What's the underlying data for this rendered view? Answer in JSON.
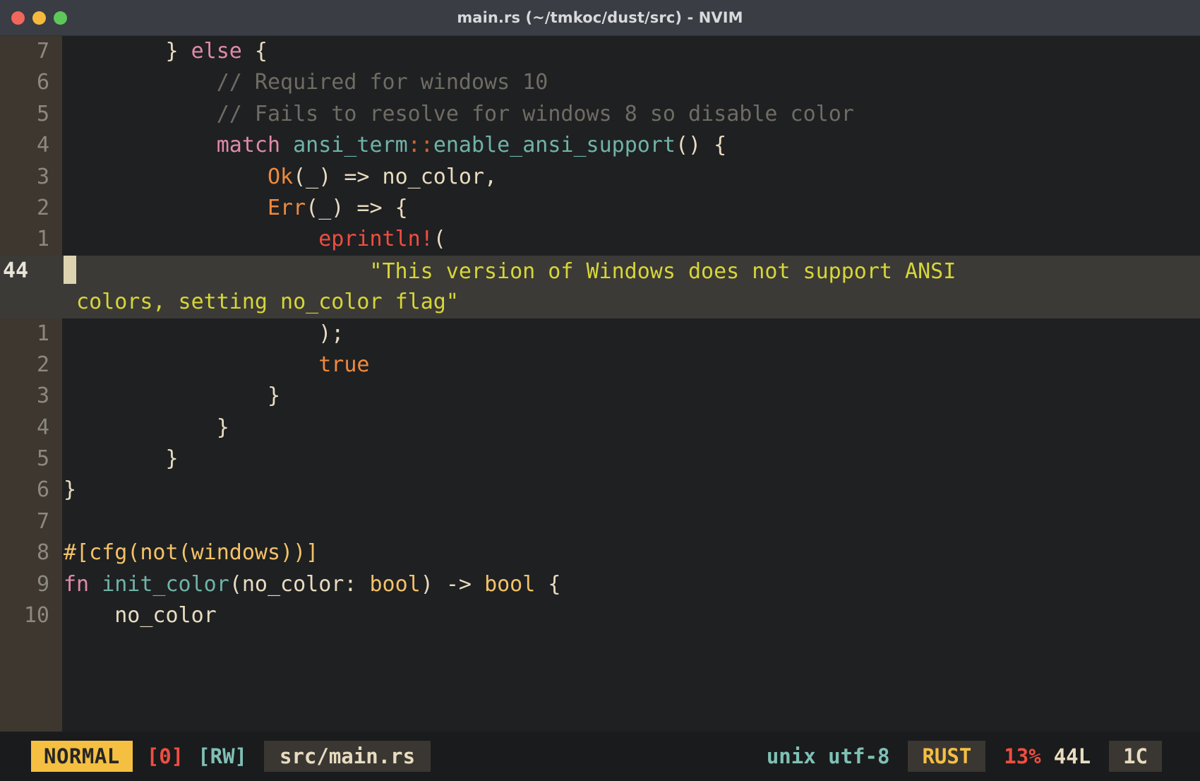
{
  "window": {
    "title": "main.rs (~/tmkoc/dust/src) - NVIM",
    "traffic_lights": {
      "close": "close-button",
      "minimize": "minimize-button",
      "maximize": "maximize-button"
    }
  },
  "editor": {
    "current_line_number": "44",
    "cursor_column": 1,
    "lines": [
      {
        "num": "7",
        "current": false,
        "segments": [
          {
            "t": "        ",
            "c": "plain"
          },
          {
            "t": "}",
            "c": "punct"
          },
          {
            "t": " ",
            "c": "plain"
          },
          {
            "t": "else",
            "c": "keyword"
          },
          {
            "t": " {",
            "c": "punct"
          }
        ]
      },
      {
        "num": "6",
        "current": false,
        "segments": [
          {
            "t": "            // Required for windows 10",
            "c": "comment"
          }
        ]
      },
      {
        "num": "5",
        "current": false,
        "segments": [
          {
            "t": "            // Fails to resolve for windows 8 so disable color",
            "c": "comment"
          }
        ]
      },
      {
        "num": "4",
        "current": false,
        "segments": [
          {
            "t": "            ",
            "c": "plain"
          },
          {
            "t": "match",
            "c": "keyword"
          },
          {
            "t": " ",
            "c": "plain"
          },
          {
            "t": "ansi_term",
            "c": "fn"
          },
          {
            "t": "::",
            "c": "sep"
          },
          {
            "t": "enable_ansi_support",
            "c": "fn"
          },
          {
            "t": "() {",
            "c": "punct"
          }
        ]
      },
      {
        "num": "3",
        "current": false,
        "segments": [
          {
            "t": "                ",
            "c": "plain"
          },
          {
            "t": "Ok",
            "c": "const"
          },
          {
            "t": "(_) ",
            "c": "punct"
          },
          {
            "t": "=>",
            "c": "op"
          },
          {
            "t": " no_color,",
            "c": "ident"
          }
        ]
      },
      {
        "num": "2",
        "current": false,
        "segments": [
          {
            "t": "                ",
            "c": "plain"
          },
          {
            "t": "Err",
            "c": "const"
          },
          {
            "t": "(_) ",
            "c": "punct"
          },
          {
            "t": "=>",
            "c": "op"
          },
          {
            "t": " {",
            "c": "punct"
          }
        ]
      },
      {
        "num": "1",
        "current": false,
        "segments": [
          {
            "t": "                    ",
            "c": "plain"
          },
          {
            "t": "eprintln!",
            "c": "macro"
          },
          {
            "t": "(",
            "c": "punct"
          }
        ]
      },
      {
        "num": "44",
        "current": true,
        "cursor": true,
        "segments": [
          {
            "t": "                       ",
            "c": "plain"
          },
          {
            "t": "\"This version of Windows does not support ANSI",
            "c": "string"
          }
        ]
      },
      {
        "num": "",
        "current": false,
        "wrapped": true,
        "segments": [
          {
            "t": " colors, setting no_color flag\"",
            "c": "string"
          }
        ]
      },
      {
        "num": "1",
        "current": false,
        "segments": [
          {
            "t": "                    );",
            "c": "punct"
          }
        ]
      },
      {
        "num": "2",
        "current": false,
        "segments": [
          {
            "t": "                    ",
            "c": "plain"
          },
          {
            "t": "true",
            "c": "const"
          }
        ]
      },
      {
        "num": "3",
        "current": false,
        "segments": [
          {
            "t": "                }",
            "c": "punct"
          }
        ]
      },
      {
        "num": "4",
        "current": false,
        "segments": [
          {
            "t": "            }",
            "c": "punct"
          }
        ]
      },
      {
        "num": "5",
        "current": false,
        "segments": [
          {
            "t": "        }",
            "c": "punct"
          }
        ]
      },
      {
        "num": "6",
        "current": false,
        "segments": [
          {
            "t": "}",
            "c": "punct"
          }
        ]
      },
      {
        "num": "7",
        "current": false,
        "segments": [
          {
            "t": "",
            "c": "plain"
          }
        ]
      },
      {
        "num": "8",
        "current": false,
        "segments": [
          {
            "t": "#[cfg(not(windows))]",
            "c": "attr"
          }
        ]
      },
      {
        "num": "9",
        "current": false,
        "segments": [
          {
            "t": "fn",
            "c": "keyword"
          },
          {
            "t": " ",
            "c": "plain"
          },
          {
            "t": "init_color",
            "c": "fn"
          },
          {
            "t": "(no_color: ",
            "c": "ident"
          },
          {
            "t": "bool",
            "c": "type"
          },
          {
            "t": ") ",
            "c": "punct"
          },
          {
            "t": "->",
            "c": "op"
          },
          {
            "t": " ",
            "c": "plain"
          },
          {
            "t": "bool",
            "c": "type"
          },
          {
            "t": " {",
            "c": "punct"
          }
        ]
      },
      {
        "num": "10",
        "current": false,
        "segments": [
          {
            "t": "    no_color",
            "c": "ident"
          }
        ]
      }
    ]
  },
  "statusline": {
    "mode": "NORMAL",
    "count": "[0]",
    "readwrite": "[RW]",
    "filepath": "src/main.rs",
    "fileformat": "unix utf-8",
    "filetype": "RUST",
    "percent": "13%",
    "linecount": "44L",
    "column": "1C"
  },
  "colors": {
    "accent_mode": "#f5bf42",
    "accent_error": "#ef4e41",
    "accent_teal": "#7fc0b5",
    "gutter_bg": "#3d3730",
    "code_bg": "#1f2022",
    "cursorline_bg": "#3c3a37",
    "cursor_block": "#ddd3b0",
    "titlebar_bg": "#3a3d44",
    "statusline_bg": "#1a1b1d"
  }
}
